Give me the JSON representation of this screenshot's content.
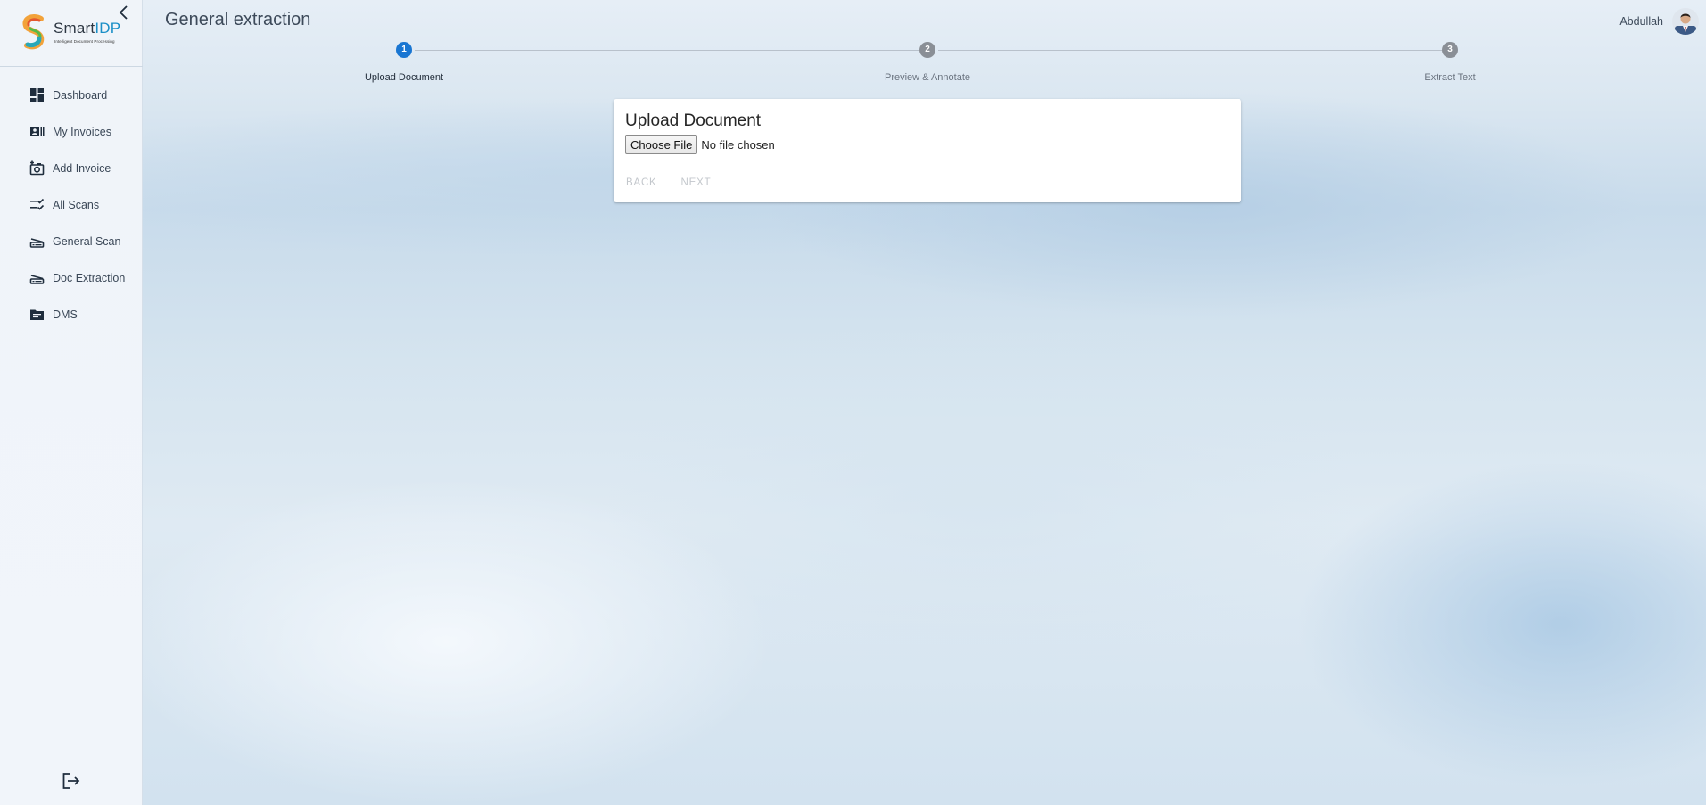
{
  "sidebar": {
    "logo": {
      "brand_main": "Smart",
      "brand_accent": "IDP",
      "tagline": "Intelligent Document Processing"
    },
    "collapse_icon": "chevron-left-icon",
    "items": [
      {
        "label": "Dashboard",
        "icon": "dashboard-icon"
      },
      {
        "label": "My Invoices",
        "icon": "invoice-list-icon"
      },
      {
        "label": "Add Invoice",
        "icon": "add-photo-icon"
      },
      {
        "label": "All Scans",
        "icon": "checklist-icon"
      },
      {
        "label": "General Scan",
        "icon": "scanner-icon"
      },
      {
        "label": "Doc Extraction",
        "icon": "scanner-icon"
      },
      {
        "label": "DMS",
        "icon": "folder-icon"
      }
    ],
    "logout_icon": "logout-icon"
  },
  "header": {
    "title": "General extraction",
    "user_name": "Abdullah"
  },
  "stepper": {
    "steps": [
      {
        "number": "1",
        "label": "Upload Document",
        "state": "active"
      },
      {
        "number": "2",
        "label": "Preview & Annotate",
        "state": "inactive"
      },
      {
        "number": "3",
        "label": "Extract Text",
        "state": "inactive"
      }
    ]
  },
  "card": {
    "title": "Upload Document",
    "file_button": "Choose File",
    "file_status": "No file chosen",
    "back_label": "BACK",
    "next_label": "NEXT"
  },
  "colors": {
    "accent": "#1976d2",
    "step_inactive": "#8a8f96",
    "brand_blue": "#1b8fc7",
    "sidebar_icon": "#1f2d3d"
  }
}
